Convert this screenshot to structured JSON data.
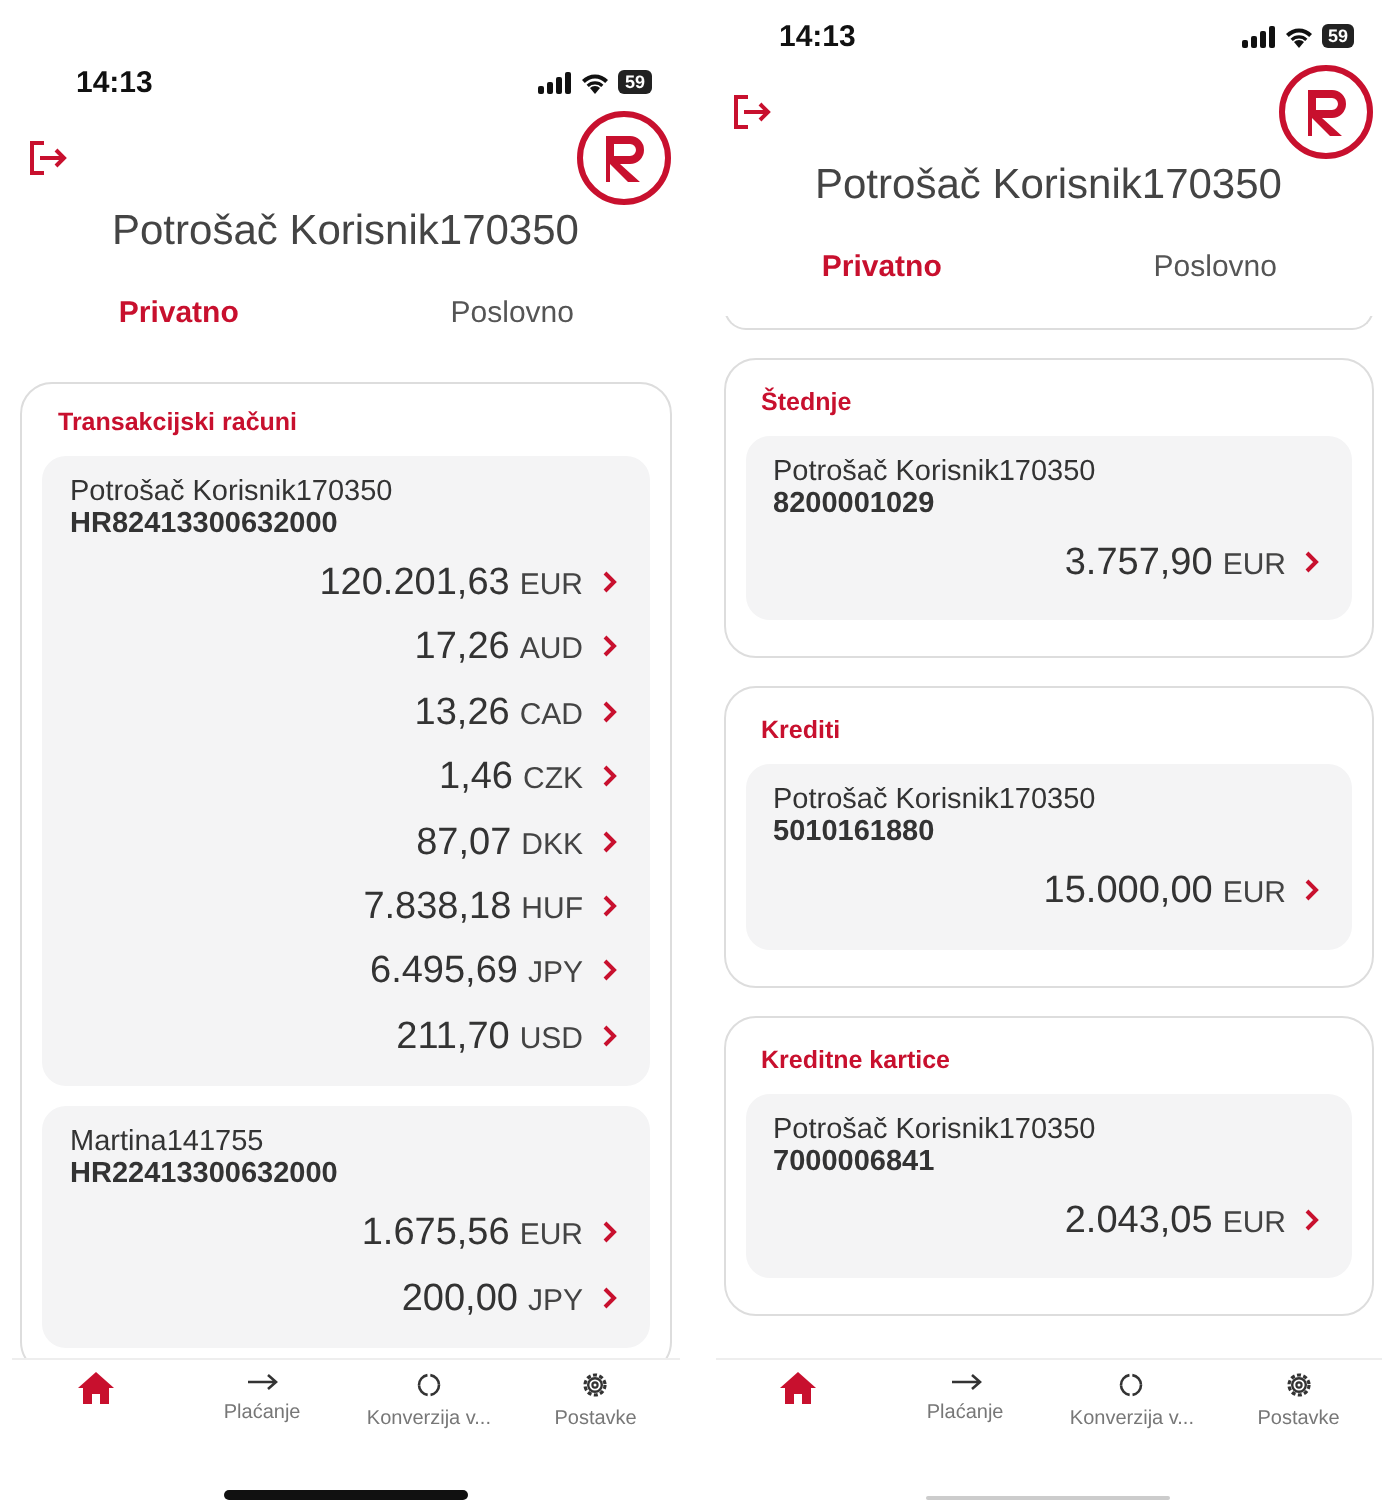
{
  "screens": [
    {
      "status_bar": {
        "time": "14:13",
        "battery": "59"
      },
      "user_name": "Potrošač Korisnik170350",
      "scrolled_past_card": false,
      "tabs": [
        {
          "label": "Privatno",
          "selected": true
        },
        {
          "label": "Poslovno",
          "selected": false
        }
      ],
      "sections": [
        {
          "title": "Transakcijski računi",
          "accounts": [
            {
              "owner": "Potrošač Korisnik170350",
              "number": "HR82413300632000",
              "balances": [
                {
                  "amount": "120.201,63",
                  "currency": "EUR"
                },
                {
                  "amount": "17,26",
                  "currency": "AUD"
                },
                {
                  "amount": "13,26",
                  "currency": "CAD"
                },
                {
                  "amount": "1,46",
                  "currency": "CZK"
                },
                {
                  "amount": "87,07",
                  "currency": "DKK"
                },
                {
                  "amount": "7.838,18",
                  "currency": "HUF"
                },
                {
                  "amount": "6.495,69",
                  "currency": "JPY"
                },
                {
                  "amount": "211,70",
                  "currency": "USD"
                }
              ]
            },
            {
              "owner": "Martina141755",
              "number": "HR22413300632000",
              "balances": [
                {
                  "amount": "1.675,56",
                  "currency": "EUR"
                },
                {
                  "amount": "200,00",
                  "currency": "JPY"
                }
              ]
            }
          ]
        }
      ],
      "nav": [
        {
          "kind": "home",
          "selected": true
        },
        {
          "kind": "arrow",
          "label": "Plaćanje",
          "selected": false
        },
        {
          "kind": "refresh",
          "label": "Konverzija v...",
          "selected": false
        },
        {
          "kind": "gear",
          "label": "Postavke",
          "selected": false
        }
      ]
    },
    {
      "status_bar": {
        "time": "14:13",
        "battery": "59"
      },
      "user_name": "Potrošač Korisnik170350",
      "scrolled_past_card": true,
      "tabs": [
        {
          "label": "Privatno",
          "selected": true
        },
        {
          "label": "Poslovno",
          "selected": false
        }
      ],
      "sections": [
        {
          "title": "Štednje",
          "accounts": [
            {
              "owner": "Potrošač Korisnik170350",
              "number": "8200001029",
              "balances": [
                {
                  "amount": "3.757,90",
                  "currency": "EUR"
                }
              ]
            }
          ]
        },
        {
          "title": "Krediti",
          "accounts": [
            {
              "owner": "Potrošač Korisnik170350",
              "number": "5010161880",
              "balances": [
                {
                  "amount": "15.000,00",
                  "currency": "EUR"
                }
              ]
            }
          ]
        },
        {
          "title": "Kreditne kartice",
          "accounts": [
            {
              "owner": "Potrošač Korisnik170350",
              "number": "7000006841",
              "balances": [
                {
                  "amount": "2.043,05",
                  "currency": "EUR"
                }
              ]
            }
          ]
        }
      ],
      "nav": [
        {
          "kind": "home",
          "selected": true
        },
        {
          "kind": "arrow",
          "label": "Plaćanje",
          "selected": false
        },
        {
          "kind": "refresh",
          "label": "Konverzija v...",
          "selected": false
        },
        {
          "kind": "gear",
          "label": "Postavke",
          "selected": false
        }
      ]
    }
  ]
}
